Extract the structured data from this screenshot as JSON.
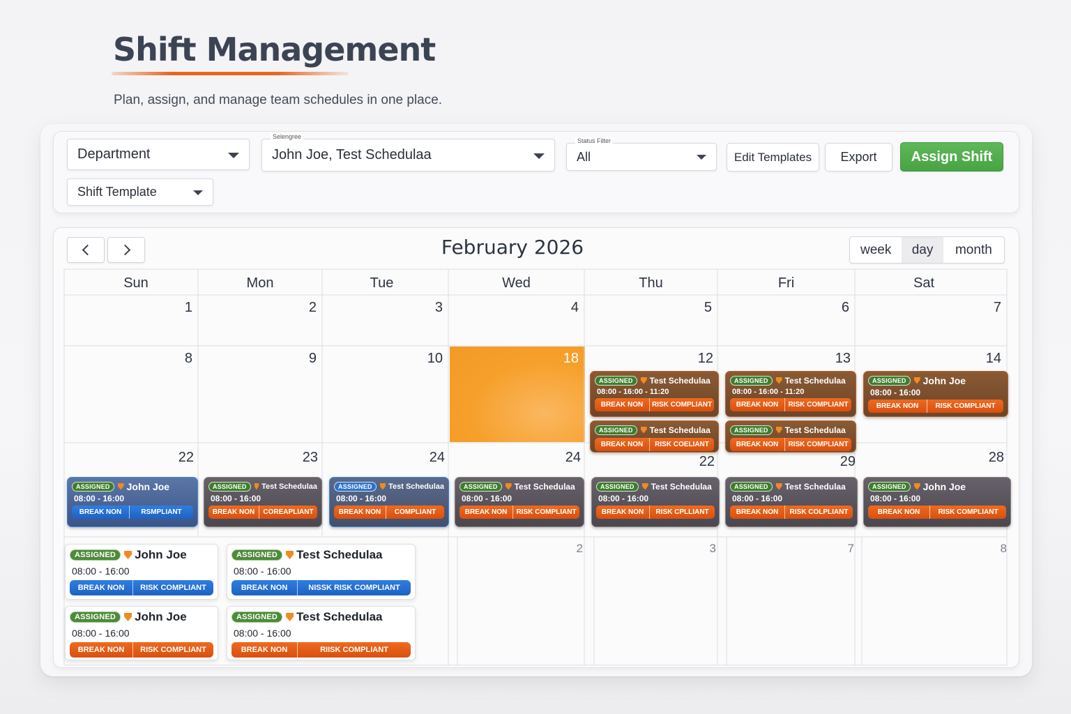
{
  "header": {
    "title": "Shift Management",
    "subtitle": "Plan, assign, and manage team schedules in one place."
  },
  "toolbar": {
    "department": "Department",
    "employees_label": "Selengree",
    "employees_value": "John Joe, Test Schedulaa",
    "status_label": "Status Filter",
    "status_value": "All",
    "edit_templates": "Edit Templates",
    "export": "Export",
    "assign_shift": "Assign Shift",
    "shift_template": "Shift Template"
  },
  "calendar": {
    "title": "February 2026",
    "views": [
      "week",
      "day",
      "month"
    ],
    "active_view": "day",
    "weekdays": [
      "Sun",
      "Mon",
      "Tue",
      "Wed",
      "Thu",
      "Fri",
      "Sat"
    ],
    "day_numbers": {
      "row1": [
        "1",
        "2",
        "3",
        "4",
        "5",
        "6",
        "7"
      ],
      "row2": [
        "8",
        "9",
        "10",
        "18",
        "12",
        "13",
        "14"
      ],
      "row3": [
        "22",
        "23",
        "24",
        "24",
        "22",
        "29",
        "28"
      ],
      "row4": [
        "2",
        "3",
        "7",
        "8"
      ]
    }
  },
  "shifts": {
    "thu_a": {
      "status": "ASSIGNED",
      "name": "Test Schedulaa",
      "time": "08:00 - 16:00 - 11:20",
      "break": "BREAK NON",
      "risk": "RISK COMPLIANT"
    },
    "thu_b": {
      "status": "ASSIGNED",
      "name": "Test Schedulaa",
      "break": "BREAK NON",
      "risk": "RISK COELIANT"
    },
    "fri_a": {
      "status": "ASSIGNED",
      "name": "Test Schedulaa",
      "time": "08:00 - 16:00 - 11:20",
      "break": "BREAK NON",
      "risk": "RISK COMPLIANT"
    },
    "fri_b": {
      "status": "ASSIGNED",
      "name": "Test Schedulaa",
      "break": "BREAK NON",
      "risk": "RISK COMPLIANT"
    },
    "sat_a": {
      "status": "ASSIGNED",
      "name": "John Joe",
      "time": "08:00 - 16:00",
      "break": "BREAK NON",
      "risk": "RISK COMPLIANT"
    },
    "r3_sun": {
      "status": "ASSIGNED",
      "name": "John Joe",
      "time": "08:00 - 16:00",
      "break": "BREAK NON",
      "risk": "RSMPLIANT"
    },
    "r3_mon": {
      "status": "ASSIGNED",
      "name": "Test Schedulaa",
      "time": "08:00 - 16:00",
      "break": "BREAK NON",
      "risk": "COREAPLIANT"
    },
    "r3_tue": {
      "status": "ASSIGNED",
      "name": "Test Schedulaa",
      "time": "08:00 - 16:00",
      "break": "BREAK NON",
      "risk": "COMPLIANT"
    },
    "r3_wed": {
      "status": "ASSIGNED",
      "name": "Test Schedulaa",
      "time": "08:00 - 16:00",
      "break": "BREAK NON",
      "risk": "RISK COMPLIANT"
    },
    "r3_thu": {
      "status": "ASSIGNED",
      "name": "Test Schedulaa",
      "time": "08:00 - 16:00",
      "break": "BREAK NON",
      "risk": "RISK CPLLIANT"
    },
    "r3_fri": {
      "status": "ASSIGNED",
      "name": "Test Schedulaa",
      "time": "08:00 - 16:00",
      "break": "BREAK NON",
      "risk": "RISK COLPLIANT"
    },
    "r3_sat": {
      "status": "ASSIGNED",
      "name": "John Joe",
      "time": "08:00 - 16:00",
      "break": "BREAK NON",
      "risk": "RISK COMPLIANT"
    },
    "l1": {
      "status": "ASSIGNED",
      "name": "John Joe",
      "time": "08:00 - 16:00",
      "break": "BREAK NON",
      "risk": "RISK COMPLIANT"
    },
    "l2": {
      "status": "ASSIGNED",
      "name": "Test Schedulaa",
      "time": "08:00 - 16:00",
      "break": "BREAK NON",
      "risk": "NISSK RISK COMPLIANT"
    },
    "l3": {
      "status": "ASSIGNED",
      "name": "John Joe",
      "time": "08:00 - 16:00",
      "break": "BREAK NON",
      "risk": "RISK COMPLIANT"
    },
    "l4": {
      "status": "ASSIGNED",
      "name": "Test Schedulaa",
      "time": "08:00 - 16:00",
      "break": "BREAK NON",
      "risk": "RIISK COMPLIANT"
    }
  },
  "colors": {
    "accent_orange": "#e8661e",
    "primary_green": "#4caf50",
    "today_orange": "#f6a02b",
    "chip_brown": "#7a4e2d",
    "chip_blue": "#3a5588"
  }
}
